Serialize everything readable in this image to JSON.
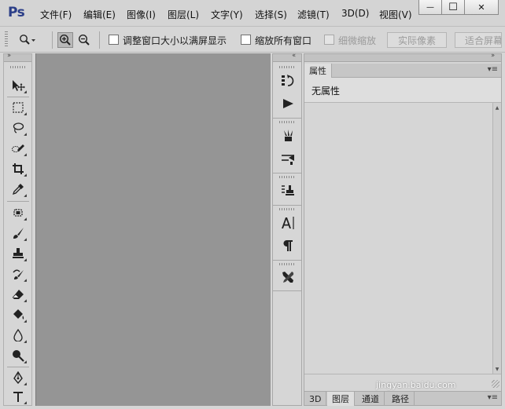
{
  "app": {
    "logo": "Ps"
  },
  "menu": [
    {
      "label": "文件(F)"
    },
    {
      "label": "编辑(E)"
    },
    {
      "label": "图像(I)"
    },
    {
      "label": "图层(L)"
    },
    {
      "label": "文字(Y)"
    },
    {
      "label": "选择(S)"
    },
    {
      "label": "滤镜(T)"
    },
    {
      "label": "3D(D)"
    },
    {
      "label": "视图(V)"
    }
  ],
  "window_controls": {
    "minimize": "—",
    "maximize": "☐",
    "close": "✕"
  },
  "options": {
    "resize_windows_label": "调整窗口大小以满屏显示",
    "zoom_all_label": "缩放所有窗口",
    "scrubby_zoom_label": "细微缩放",
    "actual_pixels_label": "实际像素",
    "fit_screen_label": "适合屏幕",
    "resize_windows_checked": false,
    "zoom_all_checked": false,
    "scrubby_zoom_checked": false
  },
  "panels": {
    "properties_tab": "属性",
    "properties_empty": "无属性",
    "bottom_tabs": [
      {
        "label": "3D"
      },
      {
        "label": "图层"
      },
      {
        "label": "通道"
      },
      {
        "label": "路径"
      }
    ]
  },
  "watermark": "jingyan.baidu.com",
  "colors": {
    "logo": "#2b3e88",
    "canvas": "#959595",
    "panel_bg": "#d6d6d6"
  }
}
